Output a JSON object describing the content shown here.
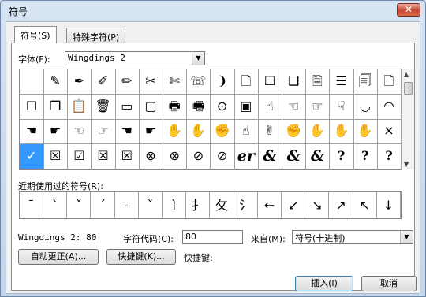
{
  "window": {
    "title": "符号",
    "close_glyph": "✕"
  },
  "tabs": [
    {
      "label": "符号(S)"
    },
    {
      "label": "特殊字符(P)"
    }
  ],
  "font": {
    "label": "字体(F):",
    "value": "Wingdings 2"
  },
  "symbol_grid": [
    [
      "",
      "✎",
      "✒",
      "✐",
      "✏",
      "✂",
      "✄",
      "☏",
      "❩",
      "🗋",
      "☐",
      "❏",
      "🗎",
      "☰",
      "🗐",
      "🗋"
    ],
    [
      "☐",
      "❐",
      "📋",
      "🗑",
      "▭",
      "▢",
      "🖶",
      "🖷",
      "⊙",
      "▣",
      "☝",
      "☜",
      "☞",
      "☟",
      "◡",
      "◠"
    ],
    [
      "☚",
      "☛",
      "☜",
      "☞",
      "☚",
      "☛",
      "✋",
      "✋",
      "✊",
      "☝",
      "✌",
      "✊",
      "✋",
      "✋",
      "✋",
      "×"
    ],
    [
      "✓",
      "☒",
      "☑",
      "☒",
      "☒",
      "⊗",
      "⊗",
      "⊘",
      "⊘",
      "er",
      "&",
      "&",
      "&",
      "?",
      "?",
      "?"
    ]
  ],
  "selected_cell": "3,0",
  "recent_label": "近期使用过的符号(R):",
  "recent": [
    "¯",
    "ˋ",
    "ˇ",
    "ˊ",
    "˗",
    "ˇ",
    "ì",
    "扌",
    "攵",
    "氵",
    "←",
    "↙",
    "↘",
    "↗",
    "↖",
    "↓"
  ],
  "char_name": "Wingdings 2: 80",
  "char_code_label": "字符代码(C):",
  "char_code_value": "80",
  "from_label": "来自(M):",
  "from_value": "符号(十进制)",
  "autocorrect_button": "自动更正(A)...",
  "shortcut_button": "快捷键(K)...",
  "shortcut_label": "快捷键:",
  "insert_button": "插入(I)",
  "cancel_button": "取消",
  "colors": {
    "selection": "#3399ff",
    "title_bg": "#c9d8ea"
  }
}
